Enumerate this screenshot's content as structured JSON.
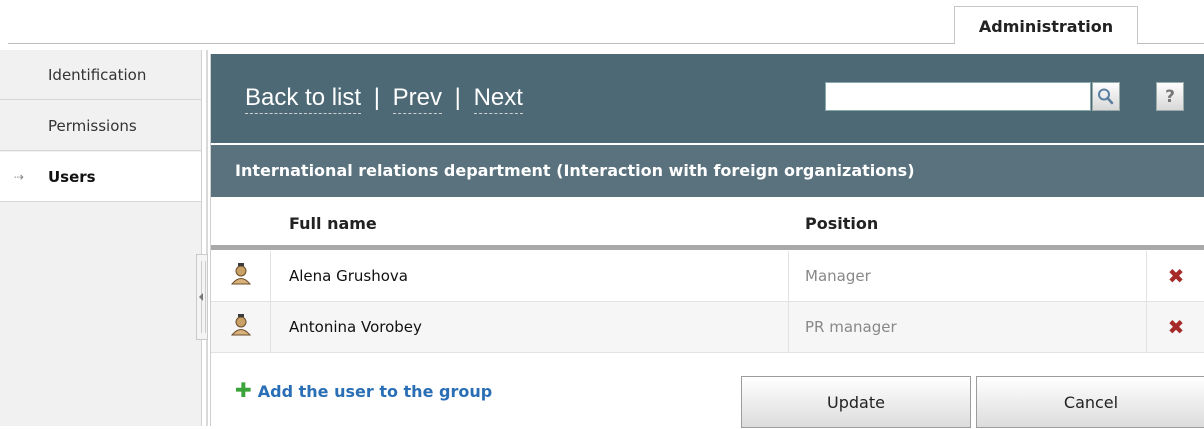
{
  "top_tab": {
    "label": "Administration"
  },
  "sidebar": {
    "items": [
      {
        "label": "Identification"
      },
      {
        "label": "Permissions"
      },
      {
        "label": "Users",
        "active": true,
        "marker": "⇢"
      }
    ]
  },
  "header": {
    "nav": {
      "back": "Back to list",
      "prev": "Prev",
      "next": "Next",
      "separator": "|"
    },
    "search": {
      "value": "",
      "icon": "search-icon"
    },
    "help_label": "?",
    "group_title": "International relations department (Interaction with foreign organizations)"
  },
  "table": {
    "columns": {
      "name": "Full name",
      "position": "Position"
    },
    "rows": [
      {
        "name": "Alena Grushova",
        "position": "Manager",
        "icon": "user-icon",
        "delete_icon": "delete-icon"
      },
      {
        "name": "Antonina Vorobey",
        "position": "PR manager",
        "icon": "user-icon",
        "delete_icon": "delete-icon"
      }
    ]
  },
  "footer": {
    "add_label": "Add the user to the group",
    "update_label": "Update",
    "cancel_label": "Cancel"
  },
  "colors": {
    "header_bg": "#4e6976",
    "subheader_bg": "#59727e",
    "link": "#2a6fb5",
    "delete": "#a52a2a",
    "add": "#3aa33a"
  }
}
